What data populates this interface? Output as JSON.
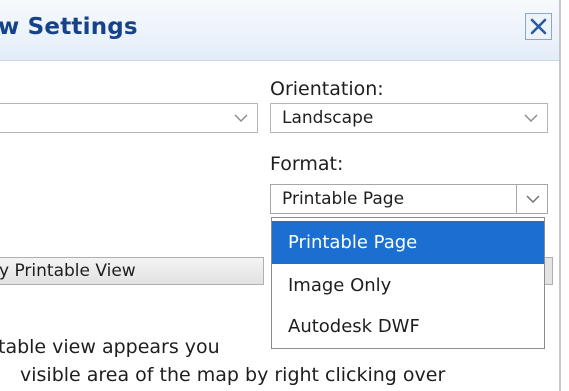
{
  "dialog": {
    "title": "w Settings",
    "close_icon": "close-icon"
  },
  "left_select": {
    "value": "",
    "chevron_icon": "chevron-down-icon"
  },
  "orientation": {
    "label": "Orientation:",
    "value": "Landscape",
    "chevron_icon": "chevron-down-icon"
  },
  "format": {
    "label": "Format:",
    "value": "Printable Page",
    "chevron_icon": "chevron-down-icon",
    "options": [
      "Printable Page",
      "Image Only",
      "Autodesk DWF"
    ],
    "selected_index": 0
  },
  "buttons": {
    "printable_view": "y Printable View"
  },
  "body": {
    "line1": "table view appears you",
    "line2": "visible area of the map by right clicking over"
  },
  "colors": {
    "title": "#15428b",
    "selection": "#1a6fd1",
    "link": "#2a72c8"
  }
}
